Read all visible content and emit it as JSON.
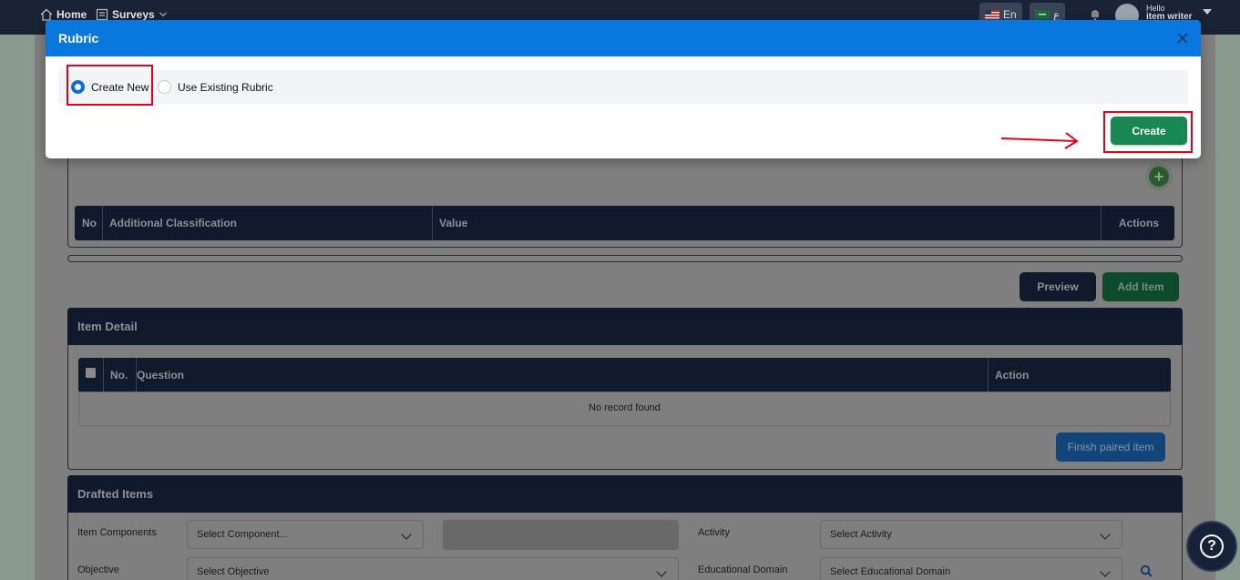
{
  "nav": {
    "home": "Home",
    "surveys": "Surveys",
    "lang_en": "En",
    "lang_ar": "ع",
    "hello": "Hello",
    "username": "item writer"
  },
  "modal": {
    "title": "Rubric",
    "option_create_new": "Create New",
    "option_use_existing": "Use Existing Rubric",
    "selected_option": "Create New",
    "create_button": "Create"
  },
  "classification_table": {
    "columns": [
      "No",
      "Additional Classification",
      "Value",
      "Actions"
    ]
  },
  "actions": {
    "preview": "Preview",
    "add_item": "Add Item"
  },
  "item_detail": {
    "title": "Item Detail",
    "columns": [
      "No.",
      "Question",
      "Action"
    ],
    "empty_text": "No record found",
    "finish_button": "Finish paired item"
  },
  "drafted_items": {
    "title": "Drafted Items",
    "item_components_label": "Item Components",
    "item_components_placeholder": "Select Component...",
    "activity_label": "Activity",
    "activity_placeholder": "Select Activity",
    "objective_label": "Objective",
    "objective_placeholder": "Select Objective",
    "educational_domain_label": "Educational Domain",
    "educational_domain_placeholder": "Select Educational Domain"
  },
  "colors": {
    "modal_header": "#0a77df",
    "create_button": "#198754",
    "highlight": "#e3001b",
    "radio_selected": "#0a6be0"
  }
}
